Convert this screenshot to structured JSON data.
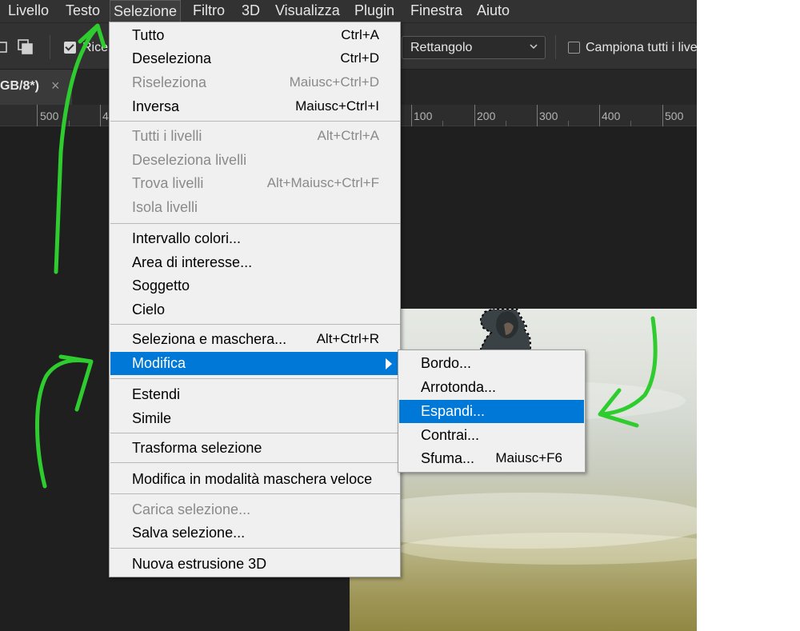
{
  "menubar": {
    "items": [
      "Livello",
      "Testo",
      "Selezione",
      "Filtro",
      "3D",
      "Visualizza",
      "Plugin",
      "Finestra",
      "Aiuto"
    ],
    "active_index": 2
  },
  "options_bar": {
    "checkbox_partial_label": "Ricer",
    "style_select_value": "Rettangolo",
    "sample_all_layers_label": "Campiona tutti i live",
    "sample_all_checked": false,
    "first_checked": true
  },
  "document_tab": {
    "title": "GB/8*)",
    "close_glyph": "×"
  },
  "ruler": {
    "labels": [
      "500",
      "4",
      "100",
      "200",
      "300",
      "400",
      "500"
    ]
  },
  "selezione_menu": {
    "items": [
      {
        "label": "Tutto",
        "shortcut": "Ctrl+A",
        "disabled": false
      },
      {
        "label": "Deseleziona",
        "shortcut": "Ctrl+D",
        "disabled": false
      },
      {
        "label": "Riseleziona",
        "shortcut": "Maiusc+Ctrl+D",
        "disabled": true
      },
      {
        "label": "Inversa",
        "shortcut": "Maiusc+Ctrl+I",
        "disabled": false
      },
      {
        "label": "Tutti i livelli",
        "shortcut": "Alt+Ctrl+A",
        "disabled": true
      },
      {
        "label": "Deseleziona livelli",
        "shortcut": "",
        "disabled": true
      },
      {
        "label": "Trova livelli",
        "shortcut": "Alt+Maiusc+Ctrl+F",
        "disabled": true
      },
      {
        "label": "Isola livelli",
        "shortcut": "",
        "disabled": true
      },
      {
        "label": "Intervallo colori...",
        "shortcut": "",
        "disabled": false
      },
      {
        "label": "Area di interesse...",
        "shortcut": "",
        "disabled": false
      },
      {
        "label": "Soggetto",
        "shortcut": "",
        "disabled": false
      },
      {
        "label": "Cielo",
        "shortcut": "",
        "disabled": false
      },
      {
        "label": "Seleziona e maschera...",
        "shortcut": "Alt+Ctrl+R",
        "disabled": false
      },
      {
        "label": "Modifica",
        "shortcut": "",
        "disabled": false,
        "highlighted": true,
        "submenu": true
      },
      {
        "label": "Estendi",
        "shortcut": "",
        "disabled": false
      },
      {
        "label": "Simile",
        "shortcut": "",
        "disabled": false
      },
      {
        "label": "Trasforma selezione",
        "shortcut": "",
        "disabled": false
      },
      {
        "label": "Modifica in modalità maschera veloce",
        "shortcut": "",
        "disabled": false
      },
      {
        "label": "Carica selezione...",
        "shortcut": "",
        "disabled": true
      },
      {
        "label": "Salva selezione...",
        "shortcut": "",
        "disabled": false
      },
      {
        "label": "Nuova estrusione 3D",
        "shortcut": "",
        "disabled": false
      }
    ]
  },
  "modifica_submenu": {
    "items": [
      {
        "label": "Bordo...",
        "shortcut": ""
      },
      {
        "label": "Arrotonda...",
        "shortcut": ""
      },
      {
        "label": "Espandi...",
        "shortcut": "",
        "highlighted": true
      },
      {
        "label": "Contrai...",
        "shortcut": ""
      },
      {
        "label": "Sfuma...",
        "shortcut": "Maiusc+F6"
      }
    ]
  },
  "colors": {
    "highlight": "#0078d7",
    "annotation": "#2ecc2e",
    "app_background": "#1f1f1f",
    "menu_background": "#f0f0f0"
  }
}
